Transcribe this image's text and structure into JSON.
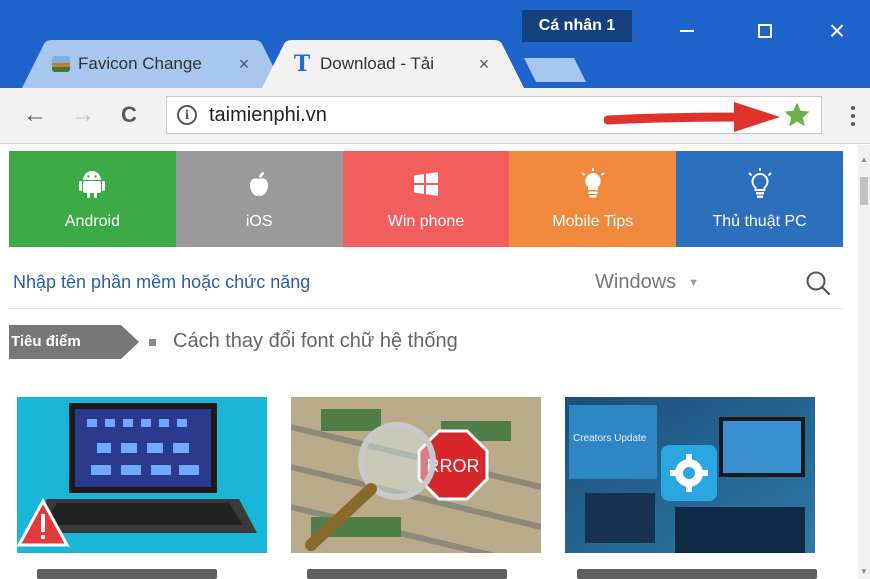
{
  "browser": {
    "profile_label": "Cá nhân 1",
    "tabs": [
      {
        "title": "Favicon Change",
        "favicon": "landscape-favicon-icon",
        "close": "×"
      },
      {
        "title": "Download - Tải",
        "favicon": "t-logo-icon",
        "close": "×",
        "favicon_letter": "T"
      }
    ],
    "window_controls": {
      "minimize": "minimize-icon",
      "maximize": "maximize-icon",
      "close": "×"
    },
    "toolbar": {
      "back": "←",
      "forward": "→",
      "reload": "C",
      "info": "i",
      "url": "taimienphi.vn"
    },
    "colors": {
      "titlebar": "#1e63c9",
      "profile": "#16417f",
      "arrow": "#e0312b",
      "star": "#6ab04c"
    }
  },
  "page": {
    "categories": [
      {
        "label": "Android",
        "icon": "android-icon",
        "color": "#3dab45"
      },
      {
        "label": "iOS",
        "icon": "apple-icon",
        "color": "#9a9a9a"
      },
      {
        "label": "Win phone",
        "icon": "windows-icon",
        "color": "#f25e5e"
      },
      {
        "label": "Mobile Tips",
        "icon": "lightbulb-icon",
        "color": "#f0883e"
      },
      {
        "label": "Thủ thuật PC",
        "icon": "idea-bulb-icon",
        "color": "#2c6fbd"
      }
    ],
    "search": {
      "placeholder": "Nhập tên phần mềm hoặc chức năng",
      "platform": "Windows",
      "platform_caret": "▼"
    },
    "focus": {
      "tag": "Tiêu điểm",
      "headline": "Cách thay đổi font chữ hệ thống"
    },
    "thumbnails": [
      {
        "name": "laptop-warning"
      },
      {
        "name": "error-magnifier",
        "text": "RROR"
      },
      {
        "name": "windows-update",
        "text": "Creators Update"
      }
    ]
  }
}
